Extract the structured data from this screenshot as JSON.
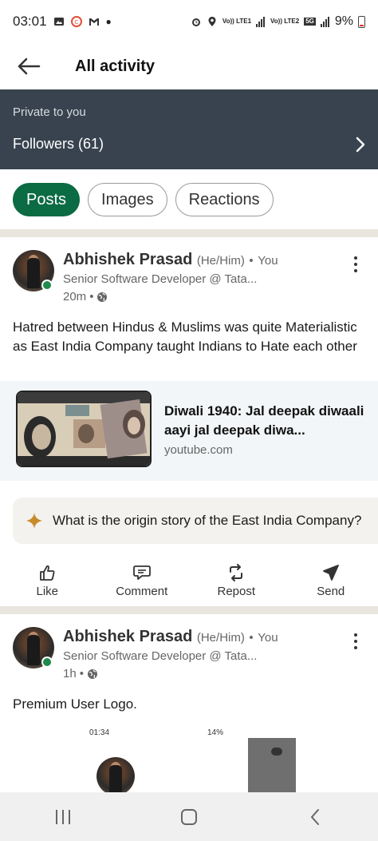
{
  "status_bar": {
    "time": "03:01",
    "left_icons": [
      "gallery-icon",
      "app-icon",
      "gmail-icon",
      "dot-icon"
    ],
    "network_1": "Vo)) LTE1",
    "network_2": "Vo)) LTE2",
    "network_type": "5G",
    "battery": "9%"
  },
  "app_bar": {
    "title": "All activity",
    "back_icon": "arrow-left-icon"
  },
  "private": {
    "label": "Private to you",
    "followers_label": "Followers (61)",
    "chevron_icon": "chevron-right-icon"
  },
  "filters": {
    "items": [
      {
        "label": "Posts",
        "active": true
      },
      {
        "label": "Images",
        "active": false
      },
      {
        "label": "Reactions",
        "active": false
      }
    ]
  },
  "posts": [
    {
      "author": "Abhishek Prasad",
      "pronouns": "(He/Him)",
      "relation": "You",
      "headline": "Senior Software Developer @ Tata...",
      "time": "20m",
      "visibility_icon": "globe-icon",
      "text": "Hatred between Hindus & Muslims was quite Materialistic as East India Company taught Indians to Hate each other",
      "link": {
        "title": "Diwali 1940: Jal deepak diwaali aayi jal deepak diwa...",
        "domain": "youtube.com"
      },
      "ai_prompt": "What is the origin story of the East India Company?"
    },
    {
      "author": "Abhishek Prasad",
      "pronouns": "(He/Him)",
      "relation": "You",
      "headline": "Senior Software Developer @ Tata...",
      "time": "1h",
      "visibility_icon": "globe-icon",
      "text": "Premium User Logo.",
      "preview": {
        "time": "01:34",
        "battery": "14%"
      }
    }
  ],
  "actions": [
    {
      "label": "Like",
      "icon": "thumbs-up-icon"
    },
    {
      "label": "Comment",
      "icon": "comment-icon"
    },
    {
      "label": "Repost",
      "icon": "repost-icon"
    },
    {
      "label": "Send",
      "icon": "send-icon"
    }
  ],
  "nav_bar": {
    "items": [
      "recents-icon",
      "home-icon",
      "back-icon"
    ]
  },
  "colors": {
    "accent": "#0b6b43",
    "banner": "#38434f",
    "online": "#1f8a4c"
  }
}
